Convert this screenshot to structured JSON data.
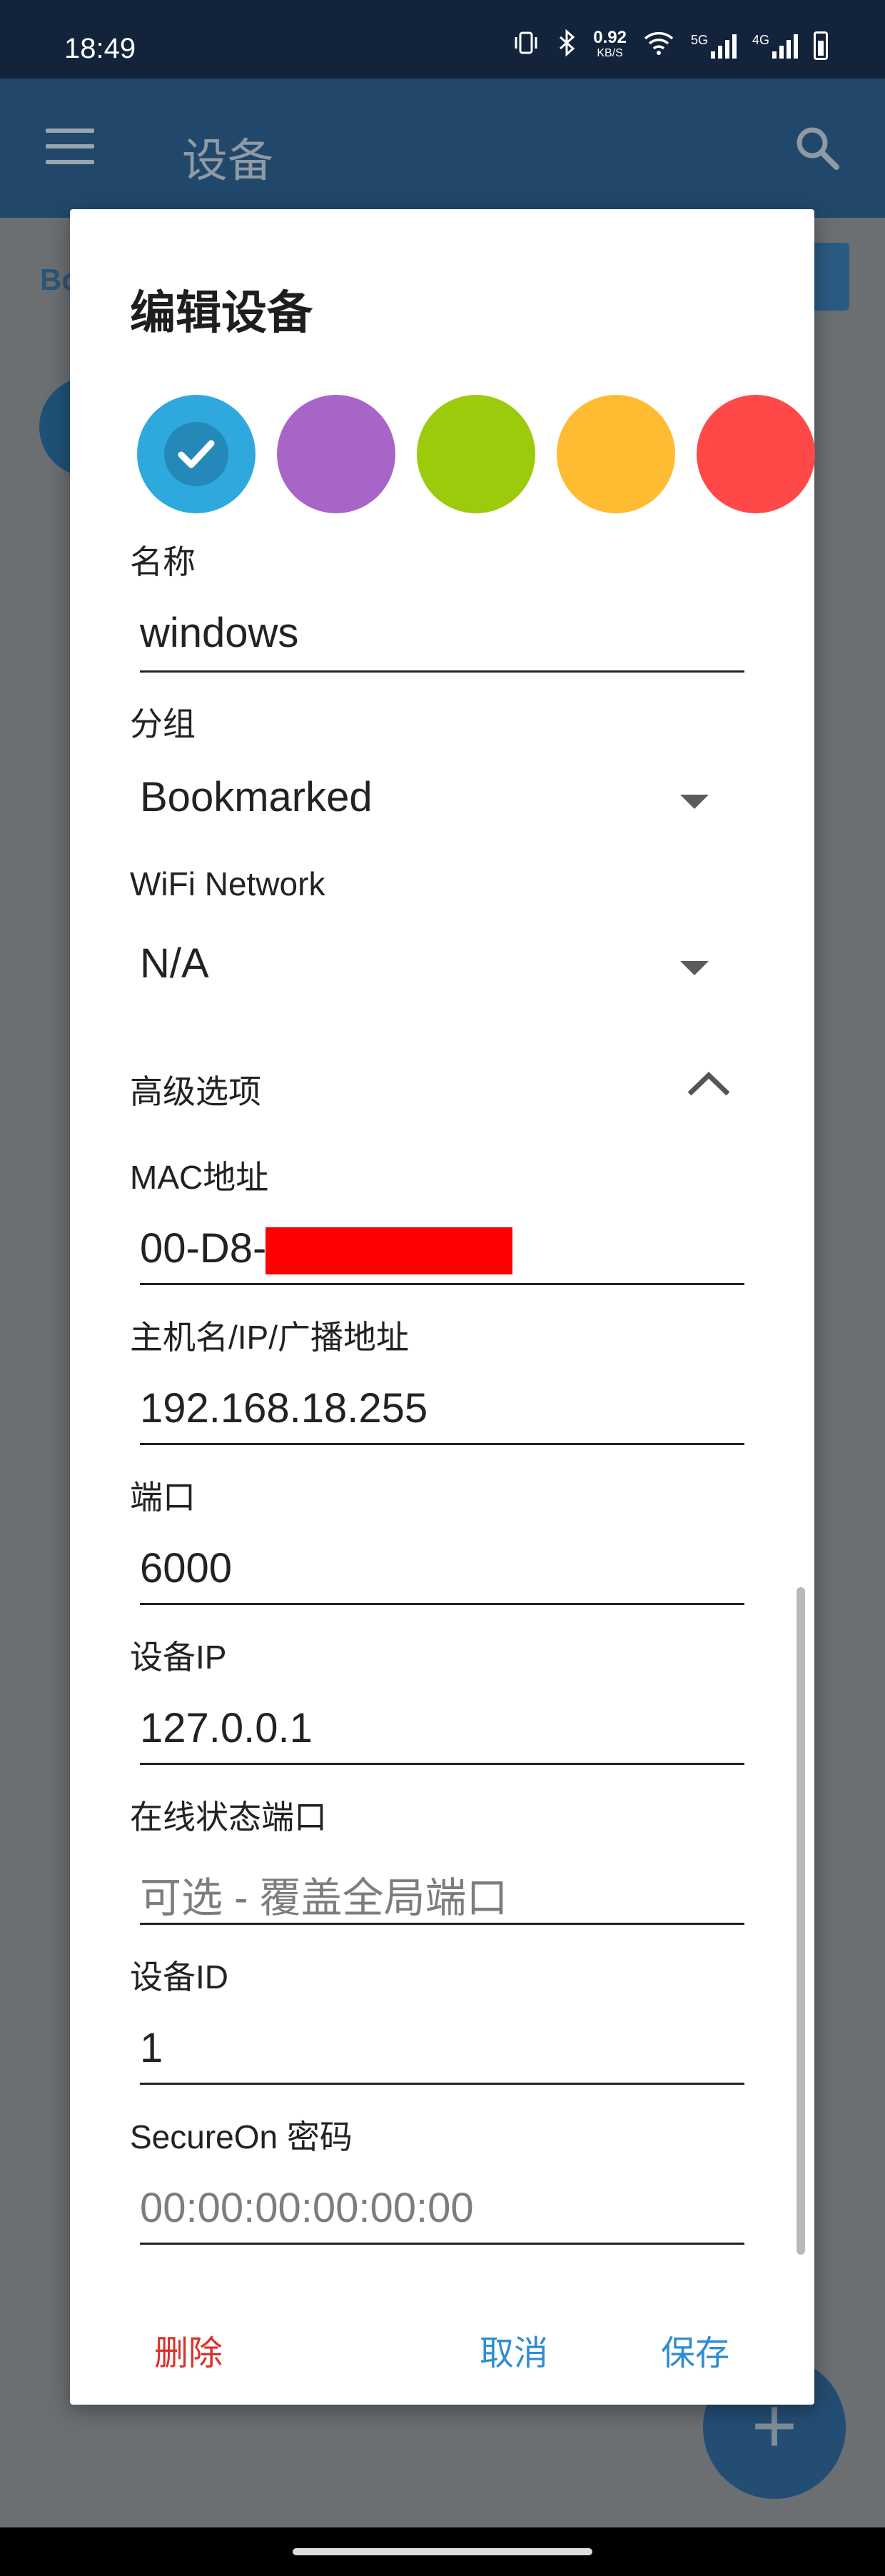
{
  "status_bar": {
    "time": "18:49",
    "net_speed_value": "0.92",
    "net_speed_unit": "KB/S",
    "net_type_1": "5G",
    "net_type_2": "4G"
  },
  "app_bar": {
    "title": "设备"
  },
  "background": {
    "chip_text": "Bo"
  },
  "dialog": {
    "title": "编辑设备",
    "colors": [
      "#2fa8dd",
      "#a765c8",
      "#9ccb0b",
      "#ffbc33",
      "#ff4949"
    ],
    "selected_color_index": 0,
    "name_label": "名称",
    "name_value": "windows",
    "group_label": "分组",
    "group_value": "Bookmarked",
    "wifi_label": "WiFi Network",
    "wifi_value": "N/A",
    "advanced_label": "高级选项",
    "mac_label": "MAC地址",
    "mac_value": "00-D8-",
    "host_label": "主机名/IP/广播地址",
    "host_value": "192.168.18.255",
    "port_label": "端口",
    "port_value": "6000",
    "device_ip_label": "设备IP",
    "device_ip_value": "127.0.0.1",
    "status_port_label": "在线状态端口",
    "status_port_placeholder": "可选 - 覆盖全局端口",
    "device_id_label": "设备ID",
    "device_id_value": "1",
    "secureon_label": "SecureOn 密码",
    "secureon_placeholder": "00:00:00:00:00:00",
    "delete_label": "删除",
    "cancel_label": "取消",
    "save_label": "保存"
  }
}
